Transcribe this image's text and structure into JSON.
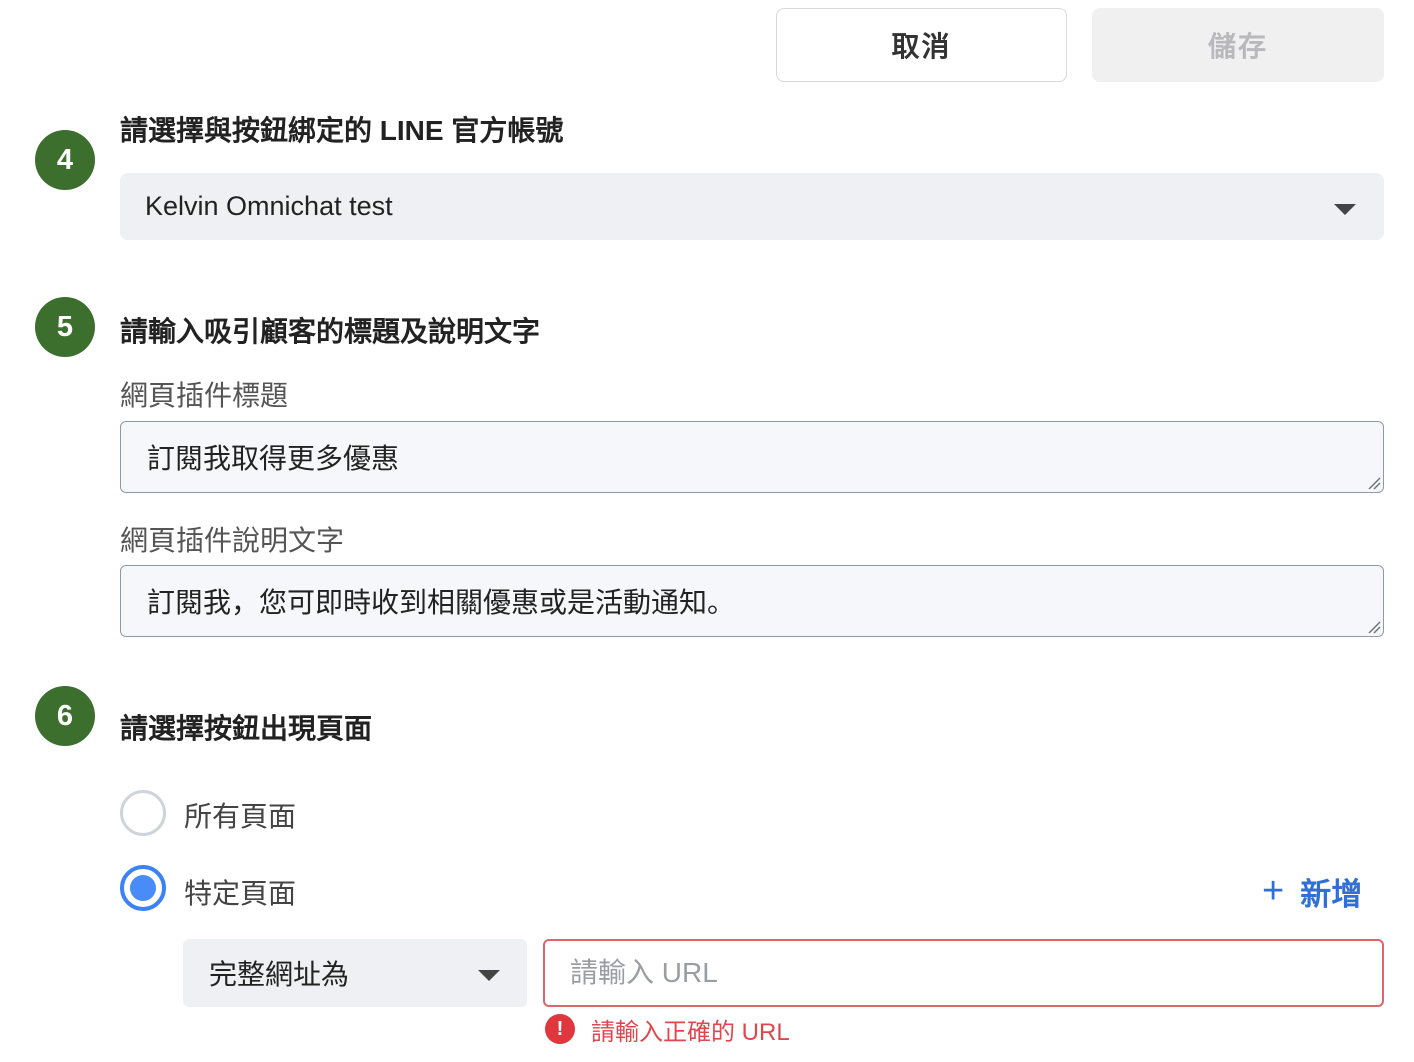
{
  "header": {
    "cancel_label": "取消",
    "save_label": "儲存"
  },
  "step4": {
    "number": "4",
    "title": "請選擇與按鈕綁定的 LINE 官方帳號",
    "account_value": "Kelvin Omnichat test"
  },
  "step5": {
    "number": "5",
    "title": "請輸入吸引顧客的標題及說明文字",
    "widget_title_label": "網頁插件標題",
    "widget_title_value": "訂閱我取得更多優惠",
    "widget_desc_label": "網頁插件說明文字",
    "widget_desc_value": "訂閱我，您可即時收到相關優惠或是活動通知。"
  },
  "step6": {
    "number": "6",
    "title": "請選擇按鈕出現頁面",
    "options": [
      {
        "label": "所有頁面",
        "selected": false
      },
      {
        "label": "特定頁面",
        "selected": true
      }
    ],
    "add_label": "新增",
    "add_icon": "plus-icon",
    "rule": {
      "match_type": "完整網址為",
      "url_value": "",
      "url_placeholder": "請輸入 URL",
      "error_text": "請輸入正確的 URL",
      "error_icon": "info-icon"
    }
  },
  "colors": {
    "badge": "#3c6f2d",
    "accent_blue": "#2f6fd6",
    "radio_selected": "#4a8cf7",
    "error_red": "#e0464d",
    "disabled_text": "#b9b9bd"
  }
}
